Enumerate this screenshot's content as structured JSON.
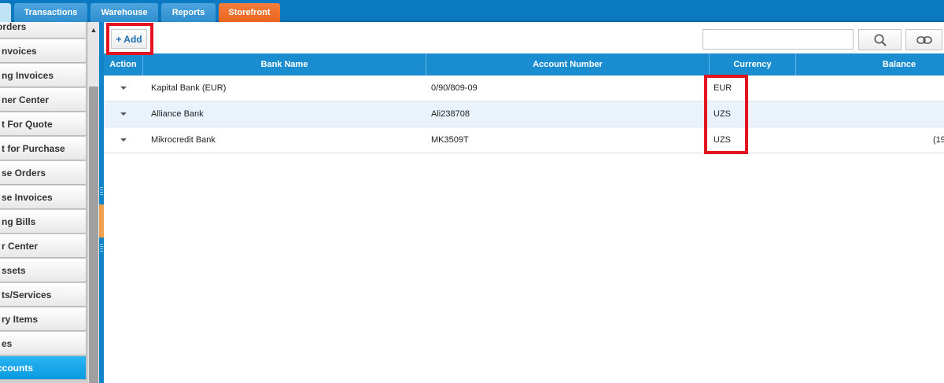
{
  "tabs": [
    {
      "label": ""
    },
    {
      "label": "Transactions"
    },
    {
      "label": "Warehouse"
    },
    {
      "label": "Reports"
    },
    {
      "label": "Storefront"
    }
  ],
  "sidebar": {
    "items": [
      {
        "label": "orders"
      },
      {
        "label": "nvoices"
      },
      {
        "label": "ng Invoices"
      },
      {
        "label": "ner Center"
      },
      {
        "label": "t For Quote"
      },
      {
        "label": "t for Purchase"
      },
      {
        "label": "se Orders"
      },
      {
        "label": "se Invoices"
      },
      {
        "label": "ng Bills"
      },
      {
        "label": "r Center"
      },
      {
        "label": "ssets"
      },
      {
        "label": "ts/Services"
      },
      {
        "label": "ry Items"
      },
      {
        "label": "es"
      },
      {
        "label": "ccounts"
      }
    ],
    "selected_index": 14
  },
  "toolbar": {
    "add_label": "+ Add",
    "search_value": "",
    "search_icon": "magnifier-icon",
    "refresh_icon": "link-icon"
  },
  "table": {
    "columns": [
      "Action",
      "Bank Name",
      "Account Number",
      "Currency",
      "Balance"
    ],
    "rows": [
      {
        "bank_name": "Kapital Bank (EUR)",
        "account_number": "0/90/809-09",
        "currency": "EUR",
        "balance": ""
      },
      {
        "bank_name": "Alliance Bank",
        "account_number": "Ali238708",
        "currency": "UZS",
        "balance": ""
      },
      {
        "bank_name": "Mikrocredit Bank",
        "account_number": "MK3509T",
        "currency": "UZS",
        "balance": "(19"
      }
    ]
  },
  "colors": {
    "header_blue": "#1a8cd0",
    "active_tab": "#f47c36",
    "selected_item": "#12a3e8",
    "highlight_red": "#e3141f"
  }
}
